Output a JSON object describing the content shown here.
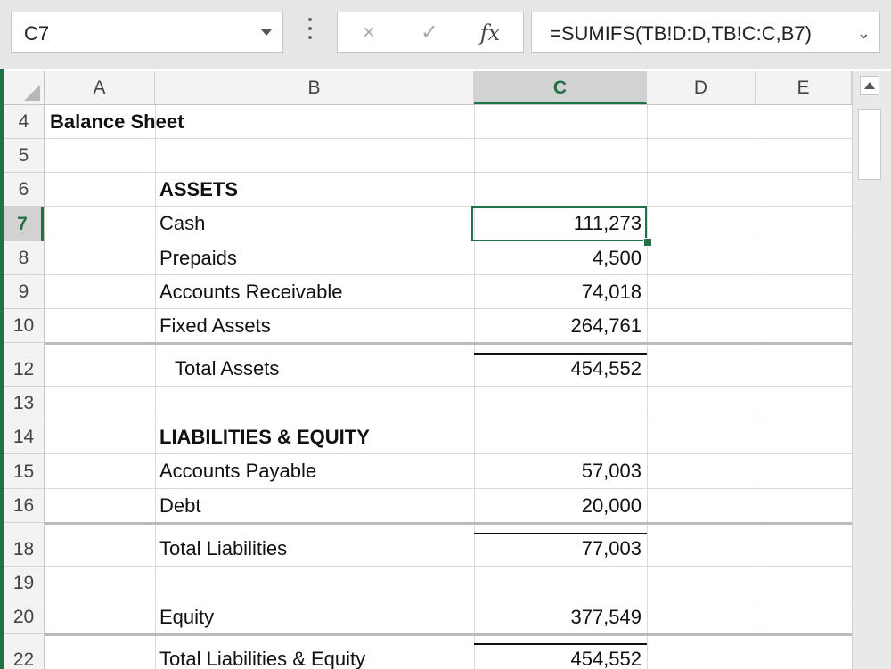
{
  "namebox": {
    "value": "C7"
  },
  "formula_bar": {
    "cancel_icon": "×",
    "enter_icon": "✓",
    "fx_label": "fx",
    "formula": "=SUMIFS(TB!D:D,TB!C:C,B7)"
  },
  "columns": [
    {
      "label": "A"
    },
    {
      "label": "B"
    },
    {
      "label": "C"
    },
    {
      "label": "D"
    },
    {
      "label": "E"
    }
  ],
  "selected_column": "C",
  "selected_row": "7",
  "rows": [
    {
      "num": "4",
      "a": "Balance Sheet",
      "b": "",
      "c": ""
    },
    {
      "num": "5",
      "a": "",
      "b": "",
      "c": ""
    },
    {
      "num": "6",
      "a": "",
      "b": "ASSETS",
      "c": ""
    },
    {
      "num": "7",
      "a": "",
      "b": "Cash",
      "c": "111,273"
    },
    {
      "num": "8",
      "a": "",
      "b": "Prepaids",
      "c": "4,500"
    },
    {
      "num": "9",
      "a": "",
      "b": "Accounts Receivable",
      "c": "74,018"
    },
    {
      "num": "10",
      "a": "",
      "b": "Fixed Assets",
      "c": "264,761"
    },
    {
      "num": "12",
      "a": "",
      "b": "Total Assets",
      "c": "454,552"
    },
    {
      "num": "13",
      "a": "",
      "b": "",
      "c": ""
    },
    {
      "num": "14",
      "a": "",
      "b": "LIABILITIES & EQUITY",
      "c": ""
    },
    {
      "num": "15",
      "a": "",
      "b": "Accounts Payable",
      "c": "57,003"
    },
    {
      "num": "16",
      "a": "",
      "b": "Debt",
      "c": "20,000"
    },
    {
      "num": "18",
      "a": "",
      "b": "Total Liabilities",
      "c": "77,003"
    },
    {
      "num": "19",
      "a": "",
      "b": "",
      "c": ""
    },
    {
      "num": "20",
      "a": "",
      "b": "Equity",
      "c": "377,549"
    },
    {
      "num": "22",
      "a": "",
      "b": "Total Liabilities & Equity",
      "c": "454,552"
    }
  ],
  "colors": {
    "accent": "#217346",
    "header_bg": "#f3f3f3",
    "gridline": "#dadada"
  }
}
